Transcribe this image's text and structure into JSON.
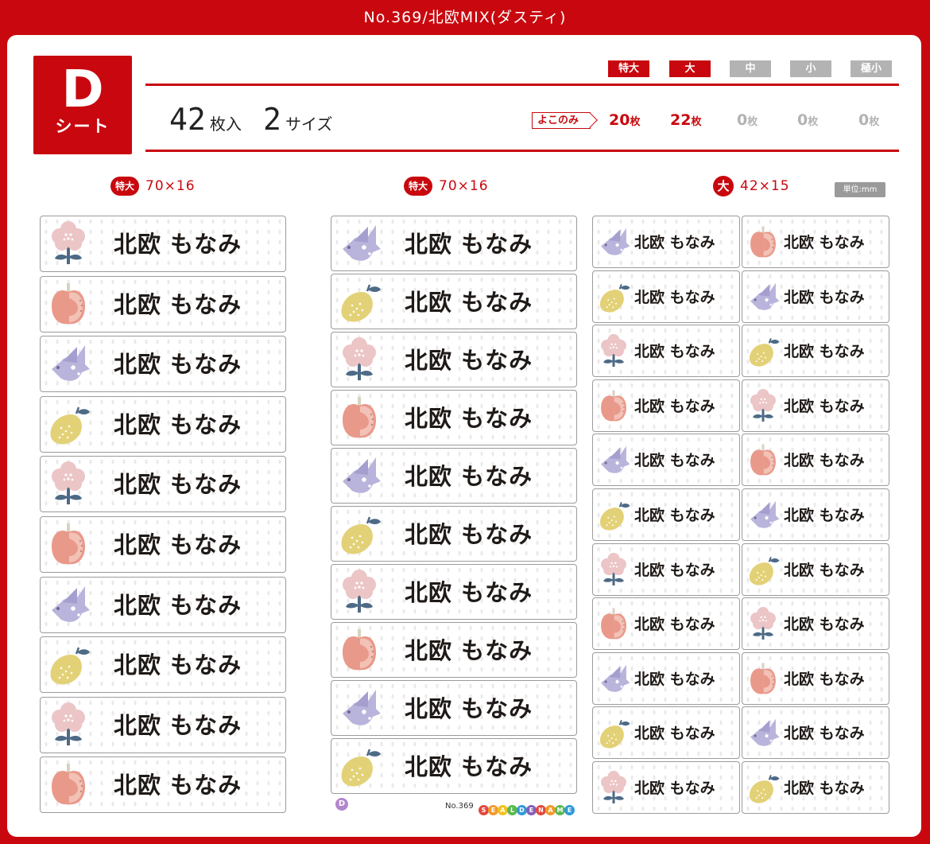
{
  "title": "No.369/北欧MIX(ダスティ)",
  "sheet_badge": {
    "letter": "D",
    "label": "シート"
  },
  "count": {
    "num": "42",
    "unit": "枚入",
    "sizes": "2",
    "sizes_unit": "サイズ"
  },
  "orientation_tag": "よこのみ",
  "size_columns": [
    {
      "label": "特大",
      "count": "20",
      "unit": "枚",
      "active": true
    },
    {
      "label": "大",
      "count": "22",
      "unit": "枚",
      "active": true
    },
    {
      "label": "中",
      "count": "0",
      "unit": "枚",
      "active": false
    },
    {
      "label": "小",
      "count": "0",
      "unit": "枚",
      "active": false
    },
    {
      "label": "極小",
      "count": "0",
      "unit": "枚",
      "active": false
    }
  ],
  "column_heads": [
    {
      "badge": "特大",
      "dim": "70×16"
    },
    {
      "badge": "特大",
      "dim": "70×16"
    },
    {
      "badge": "大",
      "dim": "42×15"
    }
  ],
  "unit_note": "単位:mm",
  "label_name": "北欧 もなみ",
  "icons": {
    "flower": "flower-icon",
    "apple": "apple-icon",
    "bird": "bird-icon",
    "lemon": "lemon-icon"
  },
  "colors": {
    "brand_red": "#c8080e",
    "flower": "#ecc5c6",
    "apple": "#e9998a",
    "bird": "#b9b4db",
    "lemon": "#e3d177",
    "stem": "#4d6a86"
  },
  "column1_icons": [
    "flower",
    "apple",
    "bird",
    "lemon",
    "flower",
    "apple",
    "bird",
    "lemon",
    "flower",
    "apple"
  ],
  "column2_icons": [
    "bird",
    "lemon",
    "flower",
    "apple",
    "bird",
    "lemon",
    "flower",
    "apple",
    "bird",
    "lemon"
  ],
  "column3a_icons": [
    "bird",
    "lemon",
    "flower",
    "apple",
    "bird",
    "lemon",
    "flower",
    "apple",
    "bird",
    "lemon",
    "flower"
  ],
  "column3b_icons": [
    "apple",
    "bird",
    "lemon",
    "flower",
    "apple",
    "bird",
    "lemon",
    "flower",
    "apple",
    "bird",
    "lemon"
  ],
  "footer": {
    "badge": "D",
    "number": "No.369",
    "logo": [
      "S",
      "E",
      "A",
      "L",
      "D",
      "E",
      "N",
      "A",
      "M",
      "E"
    ]
  }
}
